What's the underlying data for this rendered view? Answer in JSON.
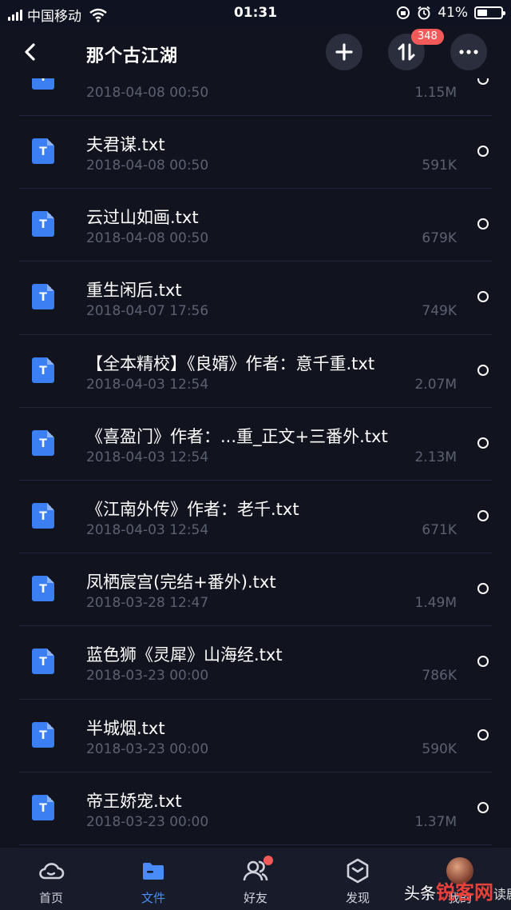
{
  "status_bar": {
    "carrier": "中国移动",
    "time": "01:31",
    "battery": "41%"
  },
  "header": {
    "title": "那个古江湖",
    "badge": "348"
  },
  "files": [
    {
      "name": "",
      "date": "2018-04-08 00:50",
      "size": "1.15M"
    },
    {
      "name": "夫君谋.txt",
      "date": "2018-04-08 00:50",
      "size": "591K"
    },
    {
      "name": "云过山如画.txt",
      "date": "2018-04-08 00:50",
      "size": "679K"
    },
    {
      "name": "重生闲后.txt",
      "date": "2018-04-07 17:56",
      "size": "749K"
    },
    {
      "name": "【全本精校】《良婿》作者：意千重.txt",
      "date": "2018-04-03 12:54",
      "size": "2.07M"
    },
    {
      "name": "《喜盈门》作者：...重_正文+三番外.txt",
      "date": "2018-04-03 12:54",
      "size": "2.13M"
    },
    {
      "name": "《江南外传》作者：老千.txt",
      "date": "2018-04-03 12:54",
      "size": "671K"
    },
    {
      "name": "凤栖宸宫(完结+番外).txt",
      "date": "2018-03-28 12:47",
      "size": "1.49M"
    },
    {
      "name": "蓝色狮《灵犀》山海经.txt",
      "date": "2018-03-23 00:00",
      "size": "786K"
    },
    {
      "name": "半城烟.txt",
      "date": "2018-03-23 00:00",
      "size": "590K"
    },
    {
      "name": "帝王娇宠.txt",
      "date": "2018-03-23 00:00",
      "size": "1.37M"
    }
  ],
  "file_icon_letter": "T",
  "tabs": [
    {
      "label": "首页",
      "icon": "cloud-icon"
    },
    {
      "label": "文件",
      "icon": "folder-icon"
    },
    {
      "label": "好友",
      "icon": "friends-icon"
    },
    {
      "label": "发现",
      "icon": "discover-icon"
    },
    {
      "label": "我的",
      "icon": "avatar"
    }
  ],
  "watermark": {
    "prefix": "头条",
    "brand": "锐客网",
    "suffix": "读剧"
  },
  "colors": {
    "accent": "#4a8cf7",
    "badge": "#f25a5a",
    "file_icon": "#3b7ff2",
    "background": "#11141f"
  }
}
